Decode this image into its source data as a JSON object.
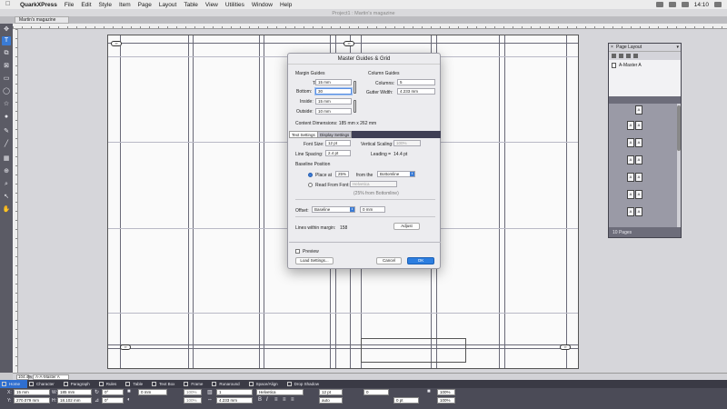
{
  "menubar": {
    "apple": "",
    "app": "QuarkXPress",
    "items": [
      "File",
      "Edit",
      "Style",
      "Item",
      "Page",
      "Layout",
      "Table",
      "View",
      "Utilities",
      "Window",
      "Help"
    ],
    "time": "14:10"
  },
  "window": {
    "title": "Project1 : Martin's magazine",
    "doc_tab": "Martin's magazine"
  },
  "tools": [
    "item-tool",
    "content-tool",
    "text-tool",
    "picture-tool",
    "frame-tool",
    "line-tool",
    "table-tool",
    "zoom-tool",
    "hand-tool"
  ],
  "page_layout": {
    "title": "Page Layout",
    "master": "A-Master A",
    "pages_footer": "10 Pages",
    "page_label": "A"
  },
  "dialog": {
    "title": "Master Guides & Grid",
    "margin_guides": {
      "heading": "Margin Guides",
      "top_label": "Top:",
      "top": "15 mm",
      "bottom_label": "Bottom:",
      "bottom": "30",
      "inside_label": "Inside:",
      "inside": "15 mm",
      "outside_label": "Outside:",
      "outside": "10 mm"
    },
    "column_guides": {
      "heading": "Column Guides",
      "columns_label": "Columns:",
      "columns": "5",
      "gutter_label": "Gutter Width:",
      "gutter": "4.233 mm"
    },
    "content_dimensions": "Content Dimensions:   185 mm x 262 mm",
    "tabs": [
      "Text Settings",
      "Display Settings"
    ],
    "font_size_label": "Font Size:",
    "font_size": "12 pt",
    "vertical_scaling_label": "Vertical Scaling:",
    "vertical_scaling": "100%",
    "line_spacing_label": "Line Spacing:",
    "line_spacing": "2.4 pt",
    "leading_label": "Leading =",
    "leading": "14.4 pt",
    "baseline_heading": "Baseline Position",
    "place_at_label": "Place at",
    "place_at": "25%",
    "from_the": "from the",
    "place_from": "Bottomline",
    "read_from_font_label": "Read From Font:",
    "read_from_font": "Helvetica",
    "read_from_note": "(25% from Bottomline)",
    "offset_label": "Offset:",
    "offset_mode": "Baseline",
    "offset_value": "0 mm",
    "lines_within_label": "Lines within margin:",
    "lines_within": "158",
    "adjust": "Adjust",
    "preview": "Preview",
    "load_settings": "Load Settings...",
    "cancel": "Cancel",
    "ok": "OK"
  },
  "statusbar": {
    "zoom": "104.4%",
    "page": "A-A-Master A"
  },
  "measurements": {
    "tabs": [
      "Home",
      "Character",
      "Paragraph",
      "Rules",
      "Table",
      "Text Box",
      "Frame",
      "Runaround",
      "Space/Align",
      "Drop Shadow"
    ],
    "x_label": "X:",
    "x": "15 mm",
    "y_label": "Y:",
    "y": "270.079 mm",
    "w_label": "W:",
    "w": "185 mm",
    "h_label": "H:",
    "h": "18.102 mm",
    "angle1": "0°",
    "angle2": "0°",
    "frame_w": "0 mm",
    "pct1": "100%",
    "pct2": "100%",
    "cols": "1",
    "gutter": "4.233 mm",
    "font": "Helvetica",
    "size": "12 pt",
    "kern": "0",
    "auto": "auto",
    "track": "0 pt",
    "scale1": "100%",
    "scale2": "100%"
  }
}
